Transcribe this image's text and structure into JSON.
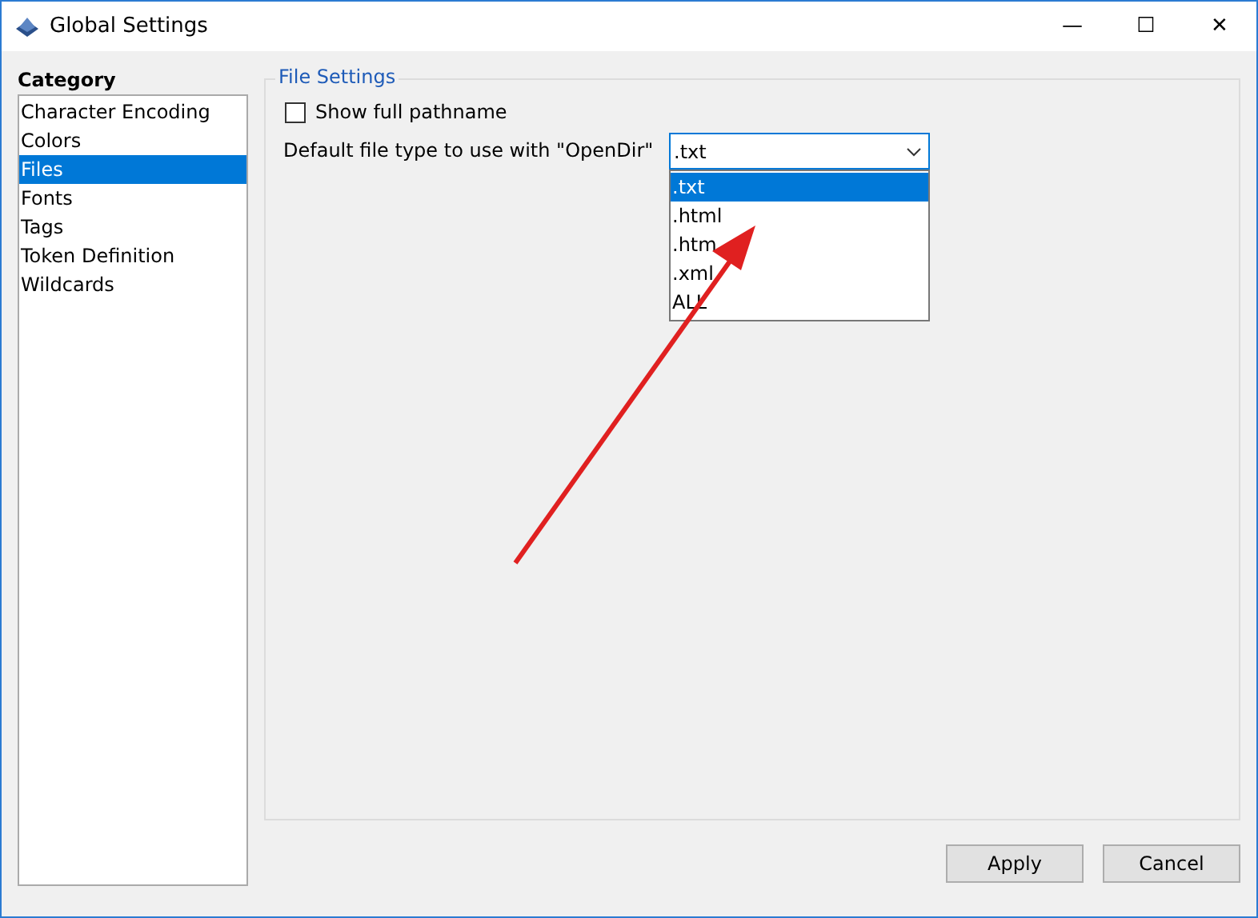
{
  "window": {
    "title": "Global Settings",
    "controls": [
      "—",
      "☐",
      "✕"
    ]
  },
  "sidebar": {
    "title": "Category",
    "items": [
      {
        "label": "Character Encoding",
        "selected": false
      },
      {
        "label": "Colors",
        "selected": false
      },
      {
        "label": "Files",
        "selected": true
      },
      {
        "label": "Fonts",
        "selected": false
      },
      {
        "label": "Tags",
        "selected": false
      },
      {
        "label": "Token Definition",
        "selected": false
      },
      {
        "label": "Wildcards",
        "selected": false
      }
    ]
  },
  "group": {
    "title": "File Settings",
    "checkbox": {
      "label": "Show full pathname",
      "checked": false
    },
    "combo": {
      "label": "Default file type to use with \"OpenDir\"",
      "value": ".txt",
      "expanded": true,
      "options": [
        {
          "label": ".txt",
          "selected": true
        },
        {
          "label": ".html",
          "selected": false
        },
        {
          "label": ".htm",
          "selected": false
        },
        {
          "label": ".xml",
          "selected": false
        },
        {
          "label": "ALL",
          "selected": false
        }
      ]
    }
  },
  "buttons": [
    "Apply",
    "Cancel"
  ]
}
